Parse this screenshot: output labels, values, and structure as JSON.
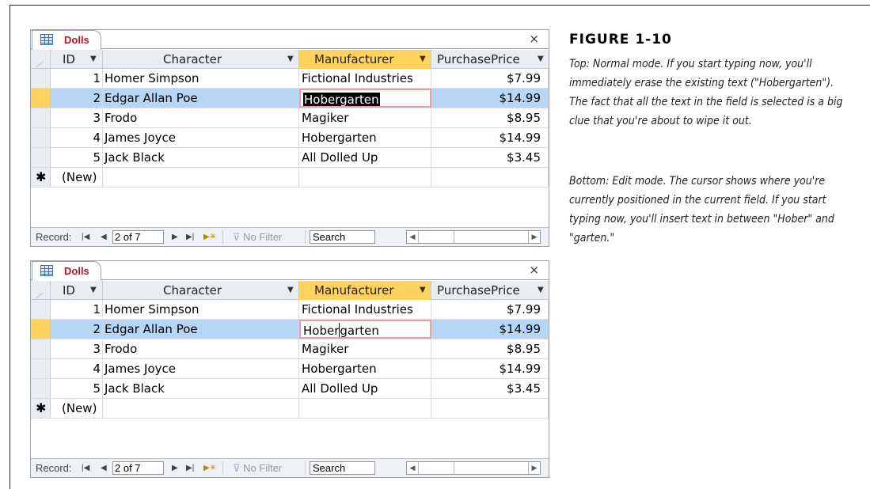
{
  "caption": {
    "title": "FIGURE 1-10",
    "paragraphs": [
      "Top: Normal mode. If you start typing now, you'll immediately erase the existing text (\"Hobergarten\"). The fact that all the text in the field is selected is a big clue that you're about to wipe it out.",
      "Bottom: Edit mode. The cursor shows where you're currently positioned in the current field. If you start typing now, you'll insert text in between \"Hober\" and \"garten.\""
    ]
  },
  "tab": {
    "label": "Dolls",
    "close": "×"
  },
  "columns": [
    "ID",
    "Character",
    "Manufacturer",
    "PurchasePrice"
  ],
  "rows": [
    {
      "id": "1",
      "character": "Homer Simpson",
      "manufacturer": "Fictional Industries",
      "price": "$7.99"
    },
    {
      "id": "2",
      "character": "Edgar Allan Poe",
      "manufacturer": "Hobergarten",
      "price": "$14.99"
    },
    {
      "id": "3",
      "character": "Frodo",
      "manufacturer": "Magiker",
      "price": "$8.95"
    },
    {
      "id": "4",
      "character": "James Joyce",
      "manufacturer": "Hobergarten",
      "price": "$14.99"
    },
    {
      "id": "5",
      "character": "Jack Black",
      "manufacturer": "All Dolled Up",
      "price": "$3.45"
    }
  ],
  "new_row": {
    "marker": "✱",
    "label": "(New)"
  },
  "edit_split": {
    "before": "Hober",
    "after": "garten"
  },
  "navbar": {
    "label": "Record:",
    "position": "2 of 7",
    "filter": "No Filter",
    "search": "Search"
  },
  "colors": {
    "selected_row": "#b7d5f5",
    "header_highlight": "#ffd25e",
    "tab_label": "#b0172b",
    "active_cell_border": "#e79fa6"
  },
  "icons": [
    "table-icon",
    "close-icon",
    "dropdown-arrow-icon",
    "first-record-icon",
    "prev-record-icon",
    "next-record-icon",
    "last-record-icon",
    "new-record-icon",
    "filter-icon"
  ]
}
